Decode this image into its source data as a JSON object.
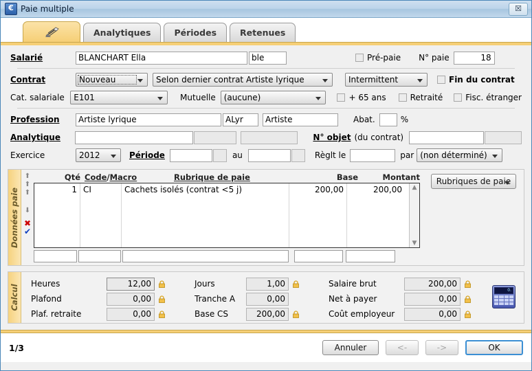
{
  "window": {
    "title": "Paie multiple",
    "app_icon": "euro-icon",
    "close_label": "☒"
  },
  "tabs": [
    {
      "label": "",
      "icon": "quill-icon",
      "active": true
    },
    {
      "label": "Analytiques",
      "active": false
    },
    {
      "label": "Périodes",
      "active": false
    },
    {
      "label": "Retenues",
      "active": false
    }
  ],
  "form": {
    "salarie_label": "Salarié",
    "salarie_value": "BLANCHART Ella",
    "salarie_code": "ble",
    "prepaie_label": "Pré-paie",
    "nopaie_label": "N° paie",
    "nopaie_value": "18",
    "contrat_label": "Contrat",
    "contrat_type": "Nouveau",
    "contrat_desc": "Selon dernier contrat Artiste lyrique",
    "contrat_statut": "Intermittent",
    "fin_contrat_label": "Fin du contrat",
    "cat_label": "Cat. salariale",
    "cat_value": "E101",
    "mutuelle_label": "Mutuelle",
    "mutuelle_value": "(aucune)",
    "plus65_label": "+ 65 ans",
    "retraite_label": "Retraité",
    "fisc_label": "Fisc. étranger",
    "profession_label": "Profession",
    "profession_value": "Artiste lyrique",
    "profession_code": "ALyr",
    "profession_cat": "Artiste",
    "abat_label": "Abat.",
    "abat_value": "",
    "abat_unit": "%",
    "analytique_label": "Analytique",
    "analytique_1": "",
    "analytique_2": "",
    "analytique_3": "",
    "nobjet_label": "N° objet",
    "nobjet_hint": "(du contrat)",
    "nobjet_value": "",
    "nobjet_value2": "",
    "exercice_label": "Exercice",
    "exercice_value": "2012",
    "periode_label": "Période",
    "periode_du": "",
    "periode_du2": "",
    "au_label": "au",
    "periode_au": "",
    "periode_au2": "",
    "reglt_label": "Règlt le",
    "reglt_value": "",
    "par_label": "par",
    "par_value": "(non déterminé)"
  },
  "grid": {
    "section_label": "Données paie",
    "columns": [
      "Qté",
      "Code / Macro",
      "Rubrique de paie",
      "Base",
      "Montant"
    ],
    "col_qte": "Qté",
    "col_code": "Code",
    "col_sep": "/",
    "col_macro": "Macro",
    "col_rubrique": "Rubrique de paie",
    "col_base": "Base",
    "col_montant": "Montant",
    "rows": [
      {
        "qte": "1",
        "code": "CI",
        "rubrique": "Cachets isolés (contrat <5 j)",
        "base": "200,00",
        "montant": "200,00"
      }
    ],
    "entry_qte": "",
    "entry_code": "",
    "entry_rubrique": "",
    "entry_base": "",
    "entry_montant": "",
    "rubriques_button": "Rubriques de paie",
    "arrows": {
      "up_first": "⬆",
      "up": "⬆",
      "up2": "⬆",
      "down": "⬇",
      "delete": "✖",
      "validate": "✔"
    },
    "scroll_up": "▲",
    "scroll_down": "▼"
  },
  "calc": {
    "section_label": "Calcul",
    "fields": [
      {
        "label": "Heures",
        "value": "12,00",
        "locked": true,
        "active": true
      },
      {
        "label": "Plafond",
        "value": "0,00",
        "locked": true,
        "active": false
      },
      {
        "label": "Plaf. retraite",
        "value": "0,00",
        "locked": true,
        "active": false
      },
      {
        "label": "Jours",
        "value": "1,00",
        "locked": true,
        "active": false
      },
      {
        "label": "Tranche A",
        "value": "0,00",
        "locked": false,
        "active": false
      },
      {
        "label": "Base CS",
        "value": "200,00",
        "locked": true,
        "active": false
      },
      {
        "label": "Salaire brut",
        "value": "200,00",
        "locked": true,
        "active": false
      },
      {
        "label": "Net à payer",
        "value": "0,00",
        "locked": true,
        "active": false
      },
      {
        "label": "Coût employeur",
        "value": "0,00",
        "locked": true,
        "active": false
      }
    ],
    "calculator_icon": "calculator-icon",
    "calculator_display": "0."
  },
  "footer": {
    "page": "1/3",
    "cancel": "Annuler",
    "prev": "<-",
    "next": "->",
    "ok": "OK"
  },
  "colors": {
    "accent_yellow": "#f6cf76",
    "title_blue": "#a8c6e0",
    "focus_blue": "#3b8fd4"
  }
}
